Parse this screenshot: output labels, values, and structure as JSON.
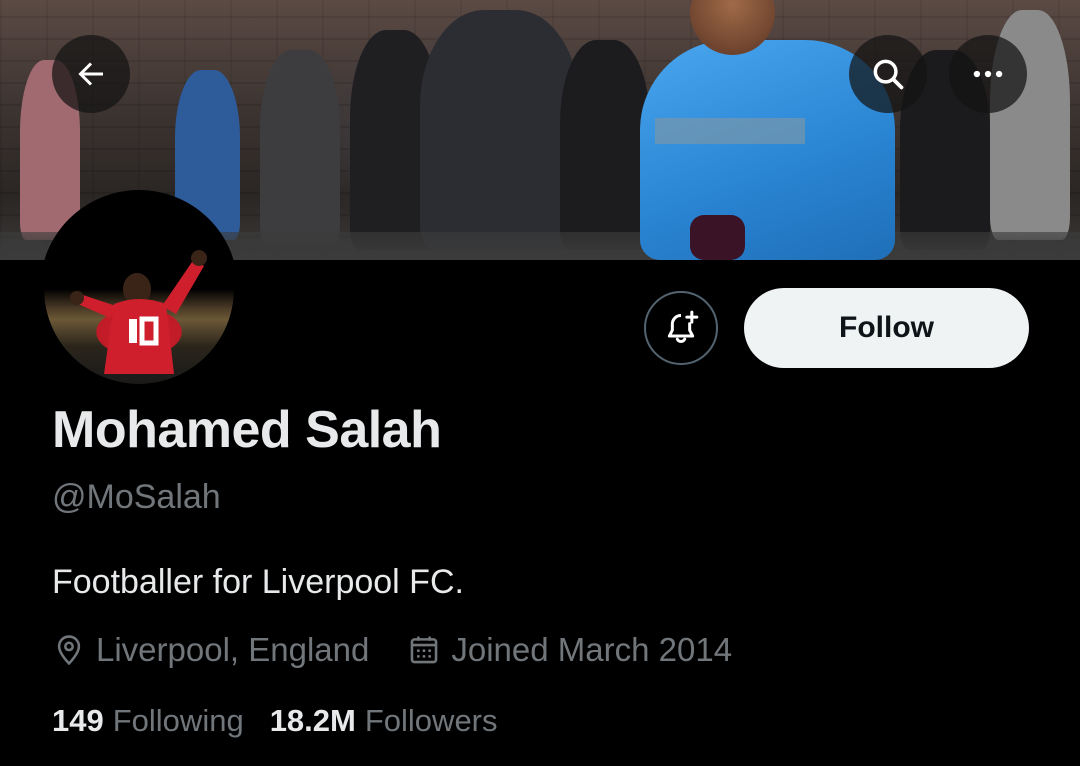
{
  "header": {
    "back_icon": "arrow-left-icon",
    "search_icon": "search-icon",
    "more_icon": "more-horizontal-icon"
  },
  "profile": {
    "display_name": "Mohamed Salah",
    "handle": "@MoSalah",
    "bio": "Footballer for Liverpool FC.",
    "location": "Liverpool, England",
    "location_icon": "location-pin-icon",
    "joined": "Joined March 2014",
    "joined_icon": "calendar-icon",
    "following_count": "149",
    "following_label": "Following",
    "followers_count": "18.2M",
    "followers_label": "Followers"
  },
  "actions": {
    "notify_icon": "bell-plus-icon",
    "follow_label": "Follow"
  },
  "colors": {
    "background": "#000000",
    "primary_text": "#e7e9ea",
    "secondary_text": "#71767b",
    "follow_button_bg": "#eff3f4"
  }
}
